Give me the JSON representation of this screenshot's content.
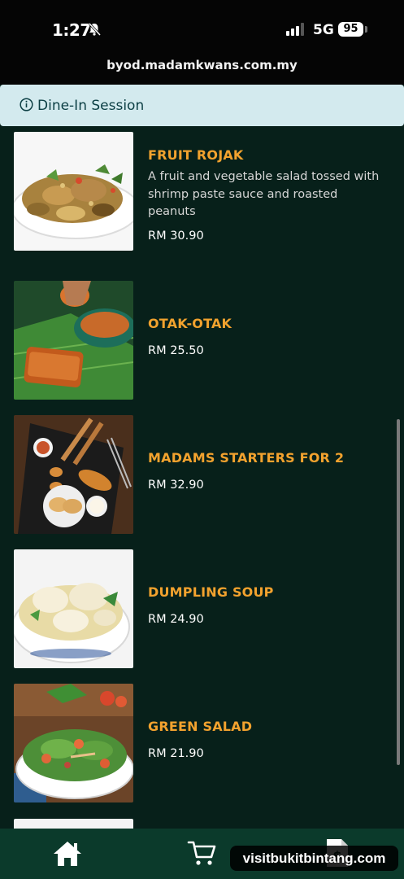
{
  "status_bar": {
    "time": "1:27",
    "network": "5G",
    "battery": "95",
    "url": "byod.madamkwans.com.my"
  },
  "session": {
    "label": "Dine-In Session"
  },
  "menu": {
    "items": [
      {
        "name": "FRUIT ROJAK",
        "description": "A fruit and vegetable salad tossed with shrimp paste sauce and roasted peanuts",
        "price": "RM 30.90"
      },
      {
        "name": "OTAK-OTAK",
        "price": "RM 25.50"
      },
      {
        "name": "MADAMS STARTERS FOR 2",
        "price": "RM 32.90"
      },
      {
        "name": "DUMPLING SOUP",
        "price": "RM 24.90"
      },
      {
        "name": "GREEN SALAD",
        "price": "RM 21.90"
      }
    ]
  },
  "bottom_nav": {
    "items": [
      "home-icon",
      "cart-icon",
      "bill-icon"
    ]
  },
  "watermark": "visitbukitbintang.com",
  "colors": {
    "background": "#07201a",
    "accent": "#f2a22e",
    "banner": "#d3eaee",
    "nav": "#0b3a2b"
  }
}
